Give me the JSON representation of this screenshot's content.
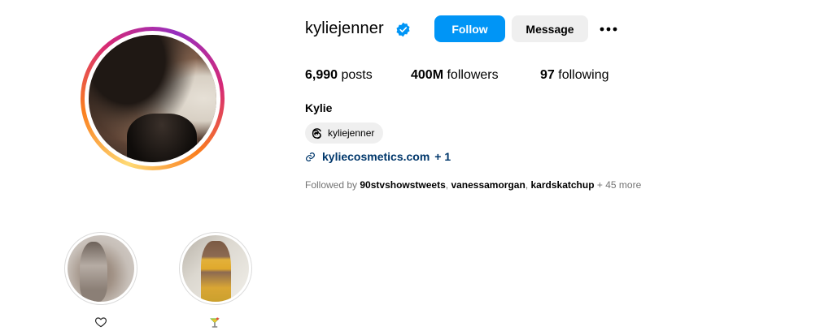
{
  "profile": {
    "username": "kyliejenner",
    "full_name": "Kylie",
    "verified": true
  },
  "actions": {
    "follow_label": "Follow",
    "message_label": "Message"
  },
  "stats": {
    "posts_count": "6,990",
    "posts_label": "posts",
    "followers_count": "400M",
    "followers_label": "followers",
    "following_count": "97",
    "following_label": "following"
  },
  "threads": {
    "handle": "kyliejenner"
  },
  "link": {
    "text": "kyliecosmetics.com",
    "extra": "+ 1"
  },
  "followed_by": {
    "prefix": "Followed by",
    "users": [
      "90stvshowstweets",
      "vanessamorgan",
      "kardskatchup"
    ],
    "more": "+ 45 more"
  },
  "highlights": [
    {
      "label_icon": "heart-icon"
    },
    {
      "label_icon": "cocktail-emoji-icon"
    }
  ],
  "colors": {
    "follow_blue": "#0095f6",
    "verified_blue": "#0095f6",
    "link_blue": "#00376b",
    "button_gray": "#efefef",
    "muted_text": "#737373"
  }
}
